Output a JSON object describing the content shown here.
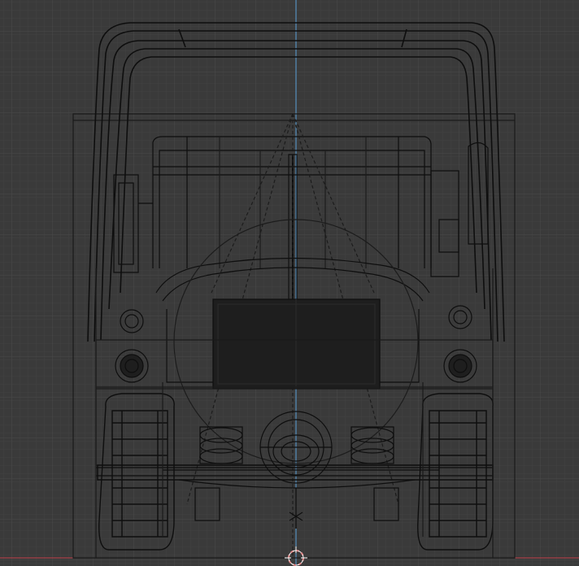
{
  "viewport": {
    "view": "front-orthographic",
    "shading": "wireframe",
    "object": "truck",
    "colors": {
      "background": "#3a3a3a",
      "grid_minor": "#414141",
      "grid_major": "#4a4a4a",
      "axis_z": "#5aa0d8",
      "axis_x": "#c0404a",
      "wire": "#0e0e0e",
      "wire_light": "#1c1c1c",
      "panel_fill": "#1e1e1e",
      "cursor": "#e08888"
    },
    "icons": {
      "cursor": "3d-cursor-icon"
    }
  }
}
